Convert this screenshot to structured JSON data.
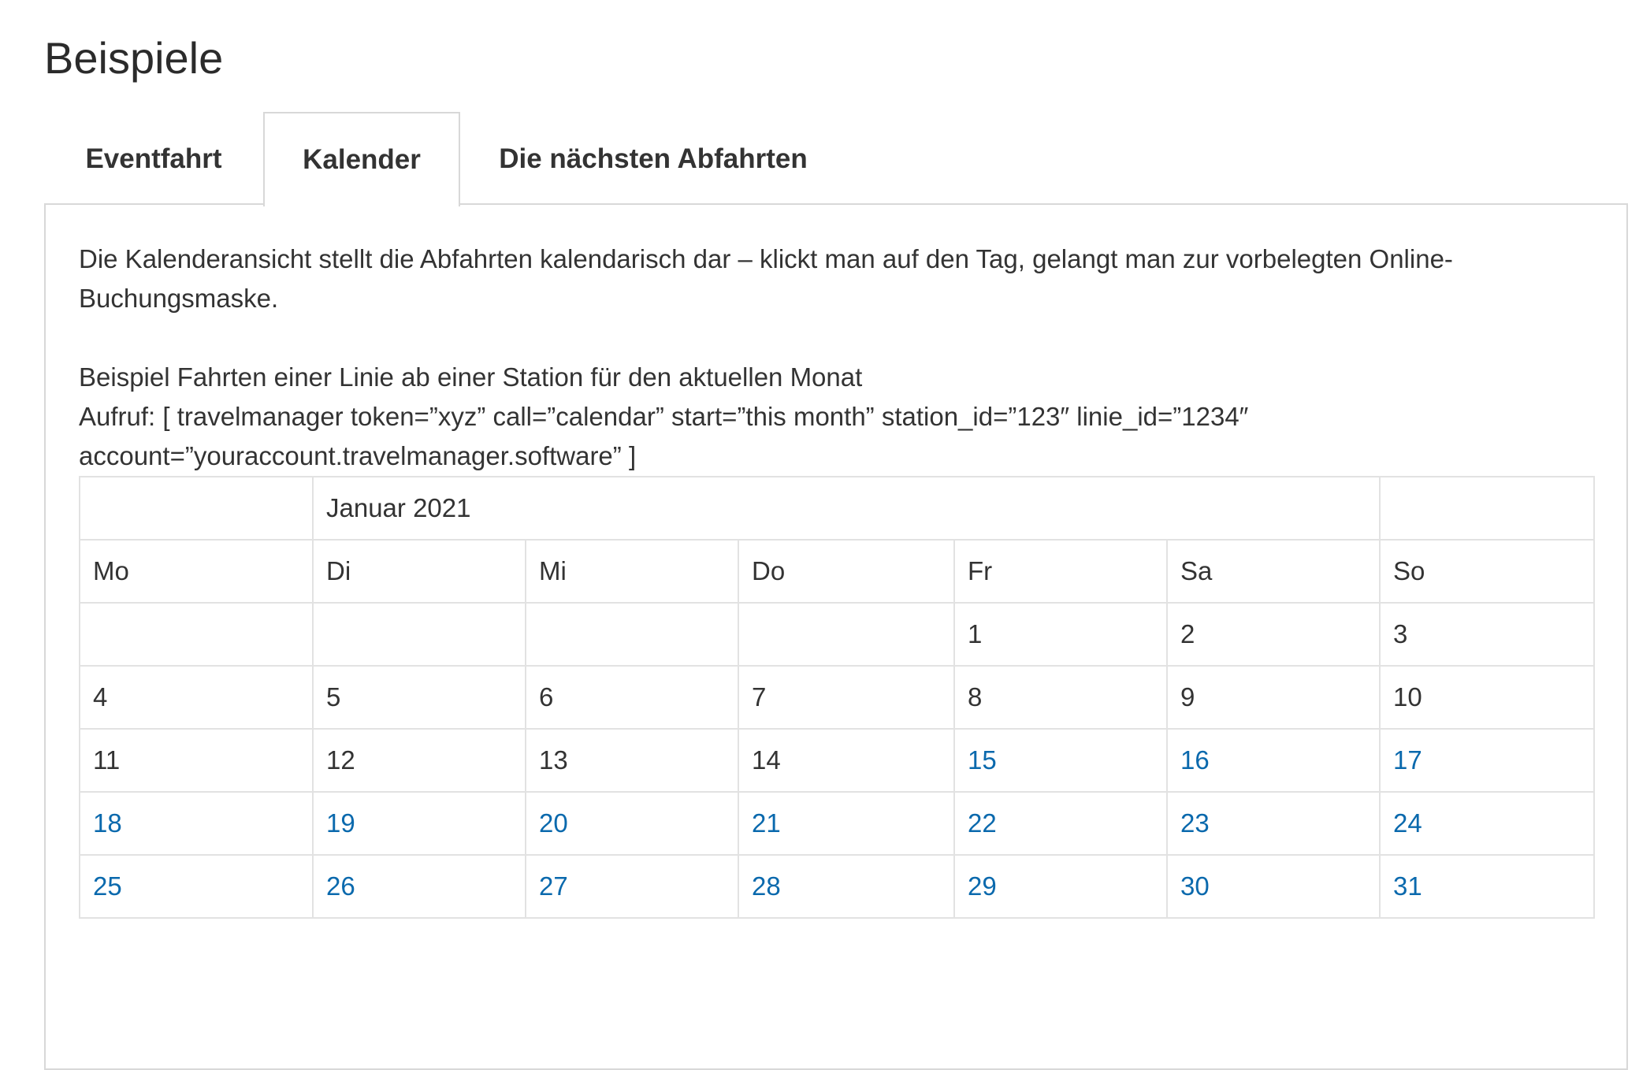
{
  "page": {
    "heading": "Beispiele"
  },
  "tabs": [
    {
      "label": "Eventfahrt",
      "active": false
    },
    {
      "label": "Kalender",
      "active": true
    },
    {
      "label": "Die nächsten Abfahrten",
      "active": false
    }
  ],
  "content": {
    "paragraph1": "Die Kalenderansicht stellt die Abfahrten kalendarisch dar – klickt man auf den Tag, gelangt man zur vorbelegten Online-Buchungsmaske.",
    "line1": "Beispiel Fahrten einer Linie ab einer Station für den aktuellen Monat",
    "line2": "Aufruf: [ travelmanager token=”xyz” call=”calendar” start=”this month” station_id=”123″ linie_id=”1234″ account=”youraccount.travelmanager.software” ]"
  },
  "calendar": {
    "month_label": "Januar 2021",
    "weekdays": [
      "Mo",
      "Di",
      "Mi",
      "Do",
      "Fr",
      "Sa",
      "So"
    ],
    "link_color": "#0a69ad",
    "weeks": [
      [
        {
          "day": ""
        },
        {
          "day": ""
        },
        {
          "day": ""
        },
        {
          "day": ""
        },
        {
          "day": "1",
          "link": false
        },
        {
          "day": "2",
          "link": false
        },
        {
          "day": "3",
          "link": false
        }
      ],
      [
        {
          "day": "4",
          "link": false
        },
        {
          "day": "5",
          "link": false
        },
        {
          "day": "6",
          "link": false
        },
        {
          "day": "7",
          "link": false
        },
        {
          "day": "8",
          "link": false
        },
        {
          "day": "9",
          "link": false
        },
        {
          "day": "10",
          "link": false
        }
      ],
      [
        {
          "day": "11",
          "link": false
        },
        {
          "day": "12",
          "link": false
        },
        {
          "day": "13",
          "link": false
        },
        {
          "day": "14",
          "link": false
        },
        {
          "day": "15",
          "link": true
        },
        {
          "day": "16",
          "link": true
        },
        {
          "day": "17",
          "link": true
        }
      ],
      [
        {
          "day": "18",
          "link": true
        },
        {
          "day": "19",
          "link": true
        },
        {
          "day": "20",
          "link": true
        },
        {
          "day": "21",
          "link": true
        },
        {
          "day": "22",
          "link": true
        },
        {
          "day": "23",
          "link": true
        },
        {
          "day": "24",
          "link": true
        }
      ],
      [
        {
          "day": "25",
          "link": true
        },
        {
          "day": "26",
          "link": true
        },
        {
          "day": "27",
          "link": true
        },
        {
          "day": "28",
          "link": true
        },
        {
          "day": "29",
          "link": true
        },
        {
          "day": "30",
          "link": true
        },
        {
          "day": "31",
          "link": true
        }
      ]
    ]
  }
}
